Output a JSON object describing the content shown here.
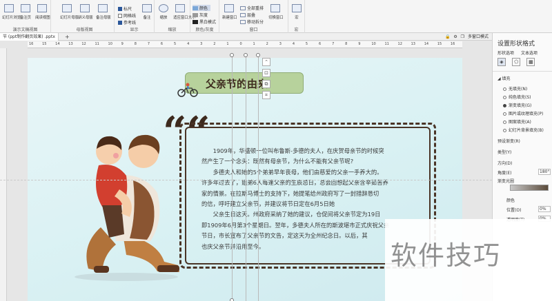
{
  "ribbon": {
    "groups": [
      {
        "label": "演示文稿视图",
        "buttons": [
          "幻灯片浏览",
          "备注页",
          "阅读视图"
        ]
      },
      {
        "label": "母版视图",
        "buttons": [
          "幻灯片母版",
          "讲义母版",
          "备注母版"
        ]
      },
      {
        "label": "显示",
        "checks": [
          "标尺",
          "网格线",
          "参考线"
        ],
        "extra": "备注"
      },
      {
        "label": "缩放",
        "buttons": [
          "缩放",
          "适应窗口大小"
        ]
      },
      {
        "label": "颜色/灰度",
        "items": [
          "颜色",
          "灰度",
          "黑白模式"
        ]
      },
      {
        "label": "窗口",
        "buttons": [
          "新建窗口"
        ],
        "items": [
          "全部重排",
          "层叠",
          "移动拆分"
        ],
        "switch": "切换窗口"
      },
      {
        "label": "宏",
        "buttons": [
          "宏"
        ]
      }
    ]
  },
  "tabs": {
    "doc_name": "节 (ppt制作翻页效果) .pptx",
    "add": "+",
    "right_label": "多窗口模式"
  },
  "ruler": {
    "ticks": [
      "16",
      "15",
      "14",
      "13",
      "12",
      "11",
      "10",
      "9",
      "8",
      "7",
      "6",
      "5",
      "4",
      "3",
      "2",
      "1",
      "0",
      "1",
      "2",
      "3",
      "4",
      "5",
      "6",
      "7",
      "8",
      "9",
      "10",
      "11",
      "12",
      "13",
      "14",
      "15",
      "16"
    ]
  },
  "slide": {
    "title": "父亲节的由来",
    "quote_mark": "“",
    "paragraphs": [
      {
        "first": "1909年，华盛顿一位叫布鲁斯-多德的夫人，在庆贺母亲节的时候突",
        "rest": [
          "然产生了一个念头：既然有母亲节，为什么不能有父亲节呢?"
        ]
      },
      {
        "first": "多德夫人和她的5个弟弟早年丧母，他们由慈爱的父亲一手养大的。",
        "rest": [
          "许多年过去了，姐弟6人每逢父亲的生辰忌日，总会回想起父亲含辛茹苦养",
          "家的情景。在拉斯马博士的支持下，她提笔给州政府写了一封措辞恳切",
          "的信，呼吁建立父亲节，并建议将节日定在6月5日她"
        ]
      },
      {
        "first": "父亲生日这天。州政府采纳了她的建议，仓促间将父亲节定为19日",
        "rest": [
          "即1909年6月第3个星期日。翌年，多德夫人所在的斯波堪市正式庆祝父亲",
          "节日，市长宣布了父亲节的文告，定这天为全州纪念日。以后，其",
          "也庆父亲节并沿用至今。"
        ]
      }
    ]
  },
  "pane": {
    "title": "设置形状格式",
    "tabs": [
      "形状选项",
      "文本选项"
    ],
    "fill_section": "填充",
    "fill_options": [
      {
        "label": "无填充(N)",
        "selected": false
      },
      {
        "label": "纯色填充(S)",
        "selected": false
      },
      {
        "label": "渐变填充(G)",
        "selected": true
      },
      {
        "label": "图片或纹理填充(P)",
        "selected": false
      },
      {
        "label": "图案填充(A)",
        "selected": false
      },
      {
        "label": "幻灯片背景填充(B)",
        "selected": false
      }
    ],
    "props": [
      "预设渐变(R)",
      "类型(Y)",
      "方向(D)",
      "角度(E)",
      "渐变光圈",
      "颜色",
      "位置(O)",
      "透明度(T)"
    ],
    "angle_value": "180°",
    "position_value": "0%",
    "transparency_value": "0%"
  },
  "watermark": "软件技巧",
  "colors": {
    "accent": "#2b579a",
    "title_pill": "#b7d29c",
    "frame": "#4a3426",
    "slide_bg": "#dcf2f4"
  }
}
